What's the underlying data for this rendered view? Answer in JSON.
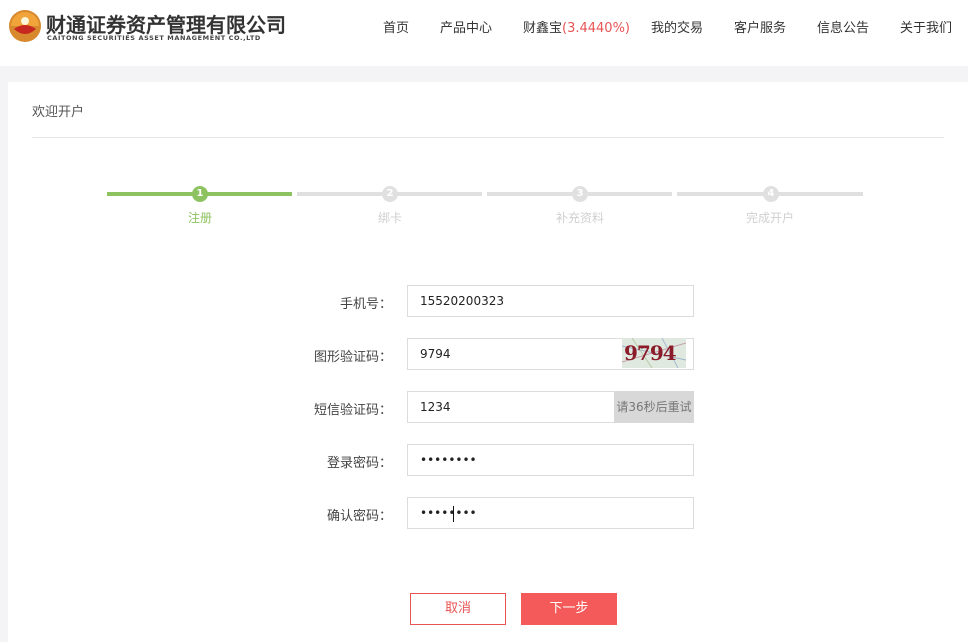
{
  "header": {
    "logo_cn": "财通证券资产管理有限公司",
    "logo_en": "CAITONG SECURITIES ASSET MANAGEMENT CO.,LTD",
    "nav": {
      "home": "首页",
      "products": "产品中心",
      "caixinbao": "财鑫宝",
      "caixinbao_rate": "(3.4440%)",
      "my_trades": "我的交易",
      "service": "客户服务",
      "notices": "信息公告",
      "about": "关于我们"
    }
  },
  "page": {
    "title": "欢迎开户"
  },
  "steps": [
    {
      "num": "1",
      "label": "注册",
      "active": true
    },
    {
      "num": "2",
      "label": "绑卡",
      "active": false
    },
    {
      "num": "3",
      "label": "补充资料",
      "active": false
    },
    {
      "num": "4",
      "label": "完成开户",
      "active": false
    }
  ],
  "form": {
    "phone_label": "手机号：",
    "phone_value": "15520200323",
    "captcha_label": "图形验证码：",
    "captcha_value": "9794",
    "captcha_image_text": "9794",
    "sms_label": "短信验证码：",
    "sms_value": "1234",
    "sms_button": "请36秒后重试",
    "password_label": "登录密码：",
    "password_value": "12345678",
    "confirm_label": "确认密码：",
    "confirm_value": "12345678"
  },
  "actions": {
    "cancel": "取消",
    "next": "下一步"
  },
  "colors": {
    "accent_green": "#8cc25f",
    "accent_red": "#f55a5a",
    "rate_red": "#e85454"
  }
}
